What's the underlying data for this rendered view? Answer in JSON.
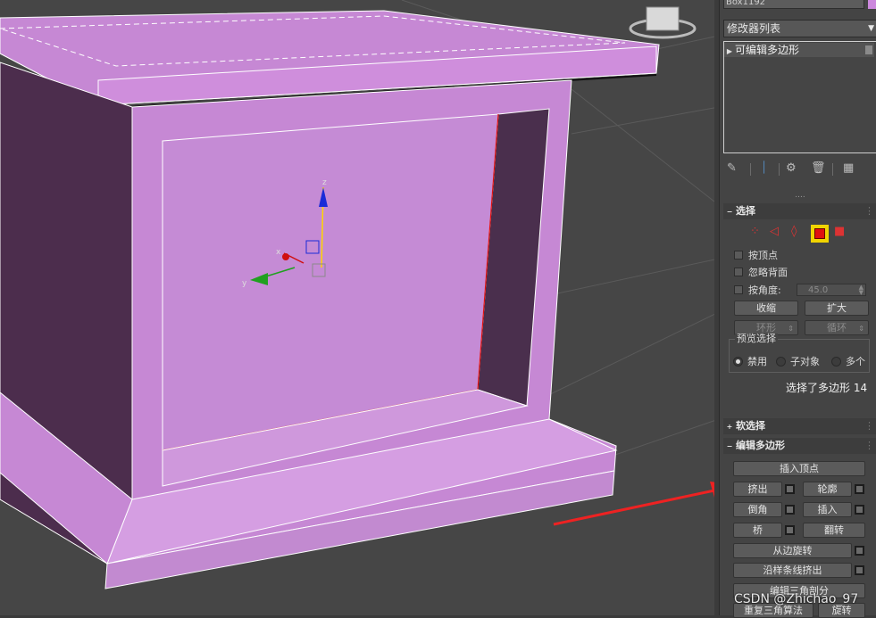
{
  "object_name": "Box1192",
  "object_color": "#cc88dd",
  "modifier_list_label": "修改器列表",
  "modifier_list_arrow": "▼",
  "stack": {
    "expand_icon": "▶",
    "item": "可编辑多边形"
  },
  "toolbar_icons": [
    "pin-icon",
    "show-end-result-icon",
    "make-unique-icon",
    "remove-modifier-icon",
    "configure-sets-icon"
  ],
  "divider": "....",
  "rollouts": {
    "selection": {
      "sign": "−",
      "title": "选择",
      "dots": "⋮",
      "by_vertex": "按顶点",
      "ignore_backfacing": "忽略背面",
      "by_angle": "按角度:",
      "angle_value": "45.0",
      "shrink": "收缩",
      "grow": "扩大",
      "ring": "环形",
      "loop": "循环",
      "preview_title": "预览选择",
      "preview_options": [
        "禁用",
        "子对象",
        "多个"
      ],
      "preview_selected": "禁用",
      "status": "选择了多边形 14"
    },
    "soft_selection": {
      "sign": "+",
      "title": "软选择",
      "dots": "⋮"
    },
    "edit_polygons": {
      "sign": "−",
      "title": "编辑多边形",
      "dots": "⋮",
      "insert_vertex": "插入顶点",
      "extrude": "挤出",
      "outline": "轮廓",
      "bevel": "倒角",
      "inset": "插入",
      "bridge": "桥",
      "flip": "翻转",
      "hinge_from_edge": "从边旋转",
      "extrude_along_spline": "沿样条线挤出",
      "edit_triangulation": "编辑三角剖分",
      "retriangulate": "重复三角算法",
      "turn": "旋转"
    }
  },
  "viewport": {
    "gizmo_axes": [
      "z",
      "x",
      "y"
    ],
    "selection_color": "#e01010",
    "object_face_color": "#cc88dd",
    "arrow_color": "#ee2222"
  },
  "watermark": "CSDN @Zhichao_97"
}
